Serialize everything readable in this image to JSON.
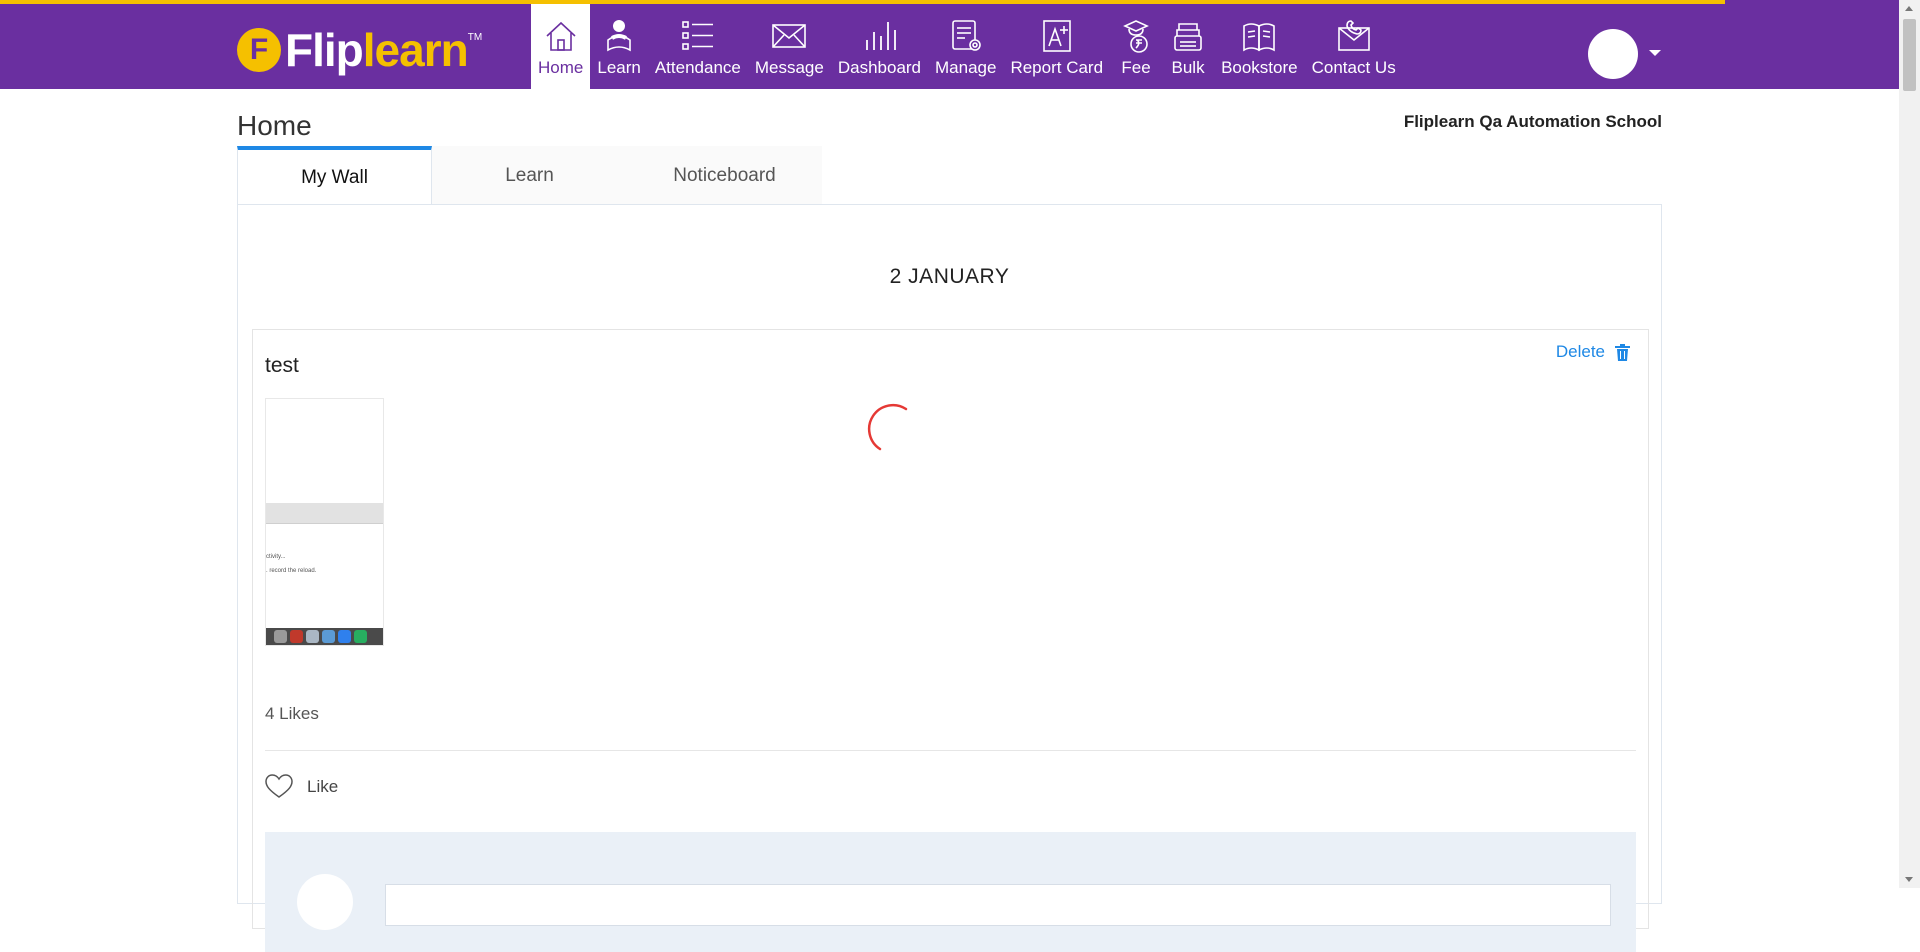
{
  "brand": {
    "logo_text_white": "Flip",
    "logo_text_yellow": "learn",
    "logo_letter": "F",
    "trademark": "TM"
  },
  "nav": {
    "items": [
      {
        "label": "Home",
        "icon": "home-icon",
        "active": true
      },
      {
        "label": "Learn",
        "icon": "learn-icon",
        "active": false
      },
      {
        "label": "Attendance",
        "icon": "attendance-icon",
        "active": false
      },
      {
        "label": "Message",
        "icon": "message-icon",
        "active": false
      },
      {
        "label": "Dashboard",
        "icon": "dashboard-icon",
        "active": false
      },
      {
        "label": "Manage",
        "icon": "manage-icon",
        "active": false
      },
      {
        "label": "Report Card",
        "icon": "report-card-icon",
        "active": false
      },
      {
        "label": "Fee",
        "icon": "fee-icon",
        "active": false
      },
      {
        "label": "Bulk",
        "icon": "bulk-icon",
        "active": false
      },
      {
        "label": "Bookstore",
        "icon": "bookstore-icon",
        "active": false
      },
      {
        "label": "Contact Us",
        "icon": "contact-us-icon",
        "active": false
      }
    ]
  },
  "page": {
    "title": "Home",
    "school": "Fliplearn Qa Automation School"
  },
  "tabs": [
    {
      "label": "My Wall",
      "active": true
    },
    {
      "label": "Learn",
      "active": false
    },
    {
      "label": "Noticeboard",
      "active": false
    }
  ],
  "wall": {
    "date_heading": "2 JANUARY",
    "post": {
      "title": "test",
      "delete_label": "Delete",
      "thumb_text_1": "ctivity...",
      "thumb_text_2": ". record the reload.",
      "likes_count": "4 Likes",
      "like_label": "Like"
    }
  },
  "colors": {
    "brand_purple": "#6a2fa0",
    "brand_yellow": "#f5c000",
    "link_blue": "#1e88e5",
    "spinner_red": "#e53935"
  }
}
